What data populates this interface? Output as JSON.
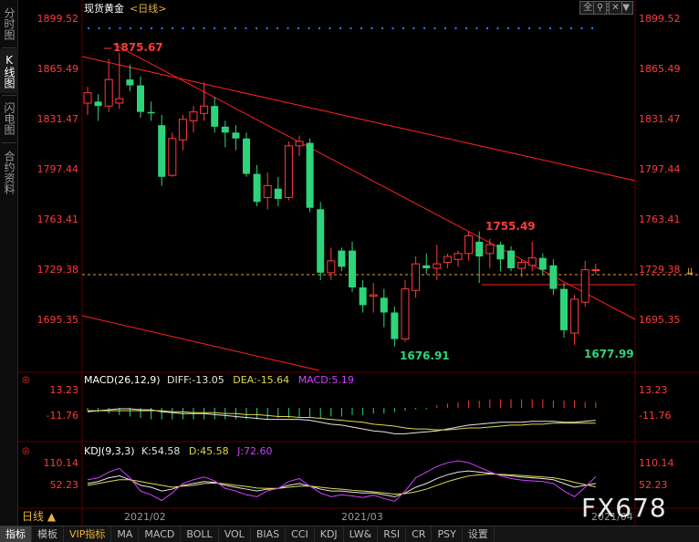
{
  "sidebar": {
    "tabs": [
      {
        "label": "分时图",
        "active": false
      },
      {
        "label": "K线图",
        "active": true
      },
      {
        "label": "闪电图",
        "active": false
      },
      {
        "label": "合约资料",
        "active": false
      }
    ]
  },
  "header": {
    "instrument": "现货黄金",
    "period_tag": "<日线>",
    "theme_select": "全部主题",
    "theme_arrow": "▼"
  },
  "price_axis": {
    "labels": [
      "1899.52",
      "1865.49",
      "1831.47",
      "1797.44",
      "1763.41",
      "1729.38",
      "1695.35"
    ],
    "current_price": "1729.38"
  },
  "annotations": {
    "high_1": "1875.67",
    "low_1": "1676.91",
    "high_2": "1755.49",
    "low_2": "1677.99"
  },
  "macd": {
    "title": "MACD(26,12,9)",
    "diff_label": "DIFF:",
    "diff_value": "-13.05",
    "dea_label": "DEA:",
    "dea_value": "-15.64",
    "macd_label": "MACD:",
    "macd_value": "5.19",
    "axis_labels": [
      "13.23",
      "-11.76"
    ]
  },
  "kdj": {
    "title": "KDJ(9,3,3)",
    "k_label": "K:",
    "k_value": "54.58",
    "d_label": "D:",
    "d_value": "45.58",
    "j_label": "J:",
    "j_value": "72.60",
    "axis_labels": [
      "110.14",
      "52.23"
    ]
  },
  "time_axis": {
    "labels": [
      "2021/02",
      "2021/03",
      "2021/04"
    ]
  },
  "period_button": {
    "label": "日线",
    "arrow": "▲"
  },
  "bottom_tabs": [
    {
      "label": "指标",
      "active": true,
      "vip": false
    },
    {
      "label": "模板",
      "active": false,
      "vip": false
    },
    {
      "label": "VIP指标",
      "active": false,
      "vip": true
    },
    {
      "label": "MA",
      "active": false,
      "vip": false
    },
    {
      "label": "MACD",
      "active": false,
      "vip": false
    },
    {
      "label": "BOLL",
      "active": false,
      "vip": false
    },
    {
      "label": "VOL",
      "active": false,
      "vip": false
    },
    {
      "label": "BIAS",
      "active": false,
      "vip": false
    },
    {
      "label": "CCI",
      "active": false,
      "vip": false
    },
    {
      "label": "KDJ",
      "active": false,
      "vip": false
    },
    {
      "label": "LW&",
      "active": false,
      "vip": false
    },
    {
      "label": "RSI",
      "active": false,
      "vip": false
    },
    {
      "label": "CR",
      "active": false,
      "vip": false
    },
    {
      "label": "PSY",
      "active": false,
      "vip": false
    },
    {
      "label": "设置",
      "active": false,
      "vip": false
    }
  ],
  "watermark": "FX678",
  "colors": {
    "up": "#ff3b3b",
    "down": "#2ed47a",
    "trend": "#ff2020",
    "price_label": "#ff3b3b",
    "diff_line": "#e6e6e6",
    "dea_line": "#e0d84a",
    "macd_text": "#d040ff",
    "j_line": "#d040ff",
    "dots": "#2a7cff"
  },
  "chart_data": {
    "type": "candlestick",
    "ylim": [
      1670,
      1905
    ],
    "candles": [
      {
        "o": 1842,
        "h": 1853,
        "l": 1834,
        "c": 1849
      },
      {
        "o": 1843,
        "h": 1848,
        "l": 1830,
        "c": 1840
      },
      {
        "o": 1840,
        "h": 1872,
        "l": 1836,
        "c": 1858
      },
      {
        "o": 1842,
        "h": 1876,
        "l": 1838,
        "c": 1845
      },
      {
        "o": 1858,
        "h": 1868,
        "l": 1850,
        "c": 1854
      },
      {
        "o": 1854,
        "h": 1860,
        "l": 1832,
        "c": 1836
      },
      {
        "o": 1836,
        "h": 1843,
        "l": 1830,
        "c": 1835
      },
      {
        "o": 1827,
        "h": 1834,
        "l": 1786,
        "c": 1792
      },
      {
        "o": 1793,
        "h": 1822,
        "l": 1792,
        "c": 1818
      },
      {
        "o": 1817,
        "h": 1834,
        "l": 1810,
        "c": 1831
      },
      {
        "o": 1830,
        "h": 1840,
        "l": 1822,
        "c": 1836
      },
      {
        "o": 1835,
        "h": 1856,
        "l": 1830,
        "c": 1840
      },
      {
        "o": 1840,
        "h": 1846,
        "l": 1822,
        "c": 1826
      },
      {
        "o": 1826,
        "h": 1830,
        "l": 1812,
        "c": 1822
      },
      {
        "o": 1822,
        "h": 1827,
        "l": 1810,
        "c": 1818
      },
      {
        "o": 1818,
        "h": 1822,
        "l": 1792,
        "c": 1794
      },
      {
        "o": 1794,
        "h": 1800,
        "l": 1772,
        "c": 1775
      },
      {
        "o": 1778,
        "h": 1795,
        "l": 1770,
        "c": 1786
      },
      {
        "o": 1784,
        "h": 1792,
        "l": 1772,
        "c": 1777
      },
      {
        "o": 1778,
        "h": 1816,
        "l": 1776,
        "c": 1813
      },
      {
        "o": 1813,
        "h": 1820,
        "l": 1806,
        "c": 1816
      },
      {
        "o": 1815,
        "h": 1818,
        "l": 1768,
        "c": 1771
      },
      {
        "o": 1770,
        "h": 1775,
        "l": 1722,
        "c": 1727
      },
      {
        "o": 1727,
        "h": 1744,
        "l": 1722,
        "c": 1735
      },
      {
        "o": 1742,
        "h": 1744,
        "l": 1728,
        "c": 1731
      },
      {
        "o": 1742,
        "h": 1748,
        "l": 1714,
        "c": 1717
      },
      {
        "o": 1717,
        "h": 1722,
        "l": 1700,
        "c": 1705
      },
      {
        "o": 1711,
        "h": 1720,
        "l": 1700,
        "c": 1712
      },
      {
        "o": 1710,
        "h": 1716,
        "l": 1690,
        "c": 1700
      },
      {
        "o": 1700,
        "h": 1704,
        "l": 1677,
        "c": 1682
      },
      {
        "o": 1682,
        "h": 1722,
        "l": 1680,
        "c": 1716
      },
      {
        "o": 1715,
        "h": 1738,
        "l": 1710,
        "c": 1733
      },
      {
        "o": 1732,
        "h": 1740,
        "l": 1726,
        "c": 1730
      },
      {
        "o": 1730,
        "h": 1746,
        "l": 1722,
        "c": 1733
      },
      {
        "o": 1734,
        "h": 1740,
        "l": 1730,
        "c": 1738
      },
      {
        "o": 1736,
        "h": 1742,
        "l": 1731,
        "c": 1740
      },
      {
        "o": 1740,
        "h": 1755,
        "l": 1735,
        "c": 1752
      },
      {
        "o": 1748,
        "h": 1755,
        "l": 1720,
        "c": 1738
      },
      {
        "o": 1740,
        "h": 1750,
        "l": 1730,
        "c": 1746
      },
      {
        "o": 1746,
        "h": 1748,
        "l": 1728,
        "c": 1736
      },
      {
        "o": 1742,
        "h": 1745,
        "l": 1728,
        "c": 1730
      },
      {
        "o": 1730,
        "h": 1736,
        "l": 1724,
        "c": 1734
      },
      {
        "o": 1732,
        "h": 1748,
        "l": 1728,
        "c": 1737
      },
      {
        "o": 1737,
        "h": 1740,
        "l": 1726,
        "c": 1729
      },
      {
        "o": 1732,
        "h": 1736,
        "l": 1712,
        "c": 1716
      },
      {
        "o": 1716,
        "h": 1720,
        "l": 1683,
        "c": 1688
      },
      {
        "o": 1686,
        "h": 1712,
        "l": 1678,
        "c": 1709
      },
      {
        "o": 1707,
        "h": 1735,
        "l": 1704,
        "c": 1729
      },
      {
        "o": 1729,
        "h": 1733,
        "l": 1726,
        "c": 1729
      }
    ],
    "macd_hist": [
      -2,
      -3,
      -4,
      -5,
      -6,
      -7,
      -8,
      -8,
      -8,
      -8,
      -8,
      -8,
      -8,
      -8,
      -8,
      -8,
      -8,
      -8,
      -7,
      -7,
      -7,
      -7,
      -7,
      -6,
      -6,
      -5,
      -5,
      -4,
      -4,
      -3,
      -2,
      -1,
      -1,
      2,
      3,
      4,
      5,
      5,
      6,
      6,
      6,
      6,
      6,
      6,
      5,
      5,
      5,
      4,
      4
    ],
    "diff": [
      -4,
      -3,
      -2,
      -1,
      -1,
      -2,
      -2,
      -4,
      -5,
      -6,
      -6,
      -6,
      -7,
      -8,
      -9,
      -10,
      -11,
      -12,
      -12,
      -12,
      -12,
      -13,
      -15,
      -17,
      -18,
      -20,
      -22,
      -24,
      -25,
      -27,
      -27,
      -26,
      -25,
      -24,
      -22,
      -20,
      -18,
      -17,
      -16,
      -15,
      -15,
      -15,
      -14,
      -14,
      -14,
      -15,
      -15,
      -14,
      -13
    ],
    "dea": [
      -3,
      -3,
      -3,
      -3,
      -3,
      -3,
      -3,
      -3,
      -4,
      -4,
      -5,
      -5,
      -5,
      -6,
      -6,
      -7,
      -7,
      -8,
      -9,
      -9,
      -10,
      -10,
      -11,
      -12,
      -13,
      -14,
      -15,
      -17,
      -18,
      -19,
      -21,
      -22,
      -22,
      -23,
      -23,
      -22,
      -21,
      -21,
      -20,
      -19,
      -18,
      -18,
      -17,
      -17,
      -16,
      -16,
      -16,
      -16,
      -16
    ],
    "k": [
      55,
      60,
      70,
      75,
      65,
      50,
      45,
      35,
      40,
      50,
      55,
      60,
      58,
      50,
      45,
      40,
      35,
      40,
      42,
      50,
      55,
      48,
      40,
      35,
      35,
      32,
      30,
      30,
      25,
      20,
      30,
      45,
      55,
      68,
      78,
      85,
      88,
      85,
      82,
      78,
      75,
      72,
      70,
      68,
      65,
      55,
      45,
      50,
      55
    ],
    "d": [
      50,
      55,
      60,
      65,
      65,
      60,
      55,
      50,
      45,
      48,
      50,
      55,
      56,
      54,
      50,
      47,
      43,
      42,
      42,
      45,
      48,
      48,
      45,
      42,
      40,
      37,
      35,
      33,
      30,
      27,
      28,
      33,
      40,
      50,
      60,
      68,
      75,
      78,
      80,
      79,
      78,
      76,
      74,
      72,
      70,
      65,
      58,
      52,
      46
    ],
    "j": [
      65,
      70,
      85,
      95,
      70,
      35,
      25,
      10,
      30,
      55,
      65,
      72,
      62,
      42,
      35,
      25,
      20,
      36,
      42,
      60,
      68,
      48,
      30,
      20,
      25,
      22,
      18,
      24,
      15,
      8,
      35,
      70,
      85,
      100,
      110,
      115,
      110,
      98,
      86,
      75,
      68,
      64,
      62,
      60,
      55,
      35,
      20,
      45,
      73
    ]
  }
}
